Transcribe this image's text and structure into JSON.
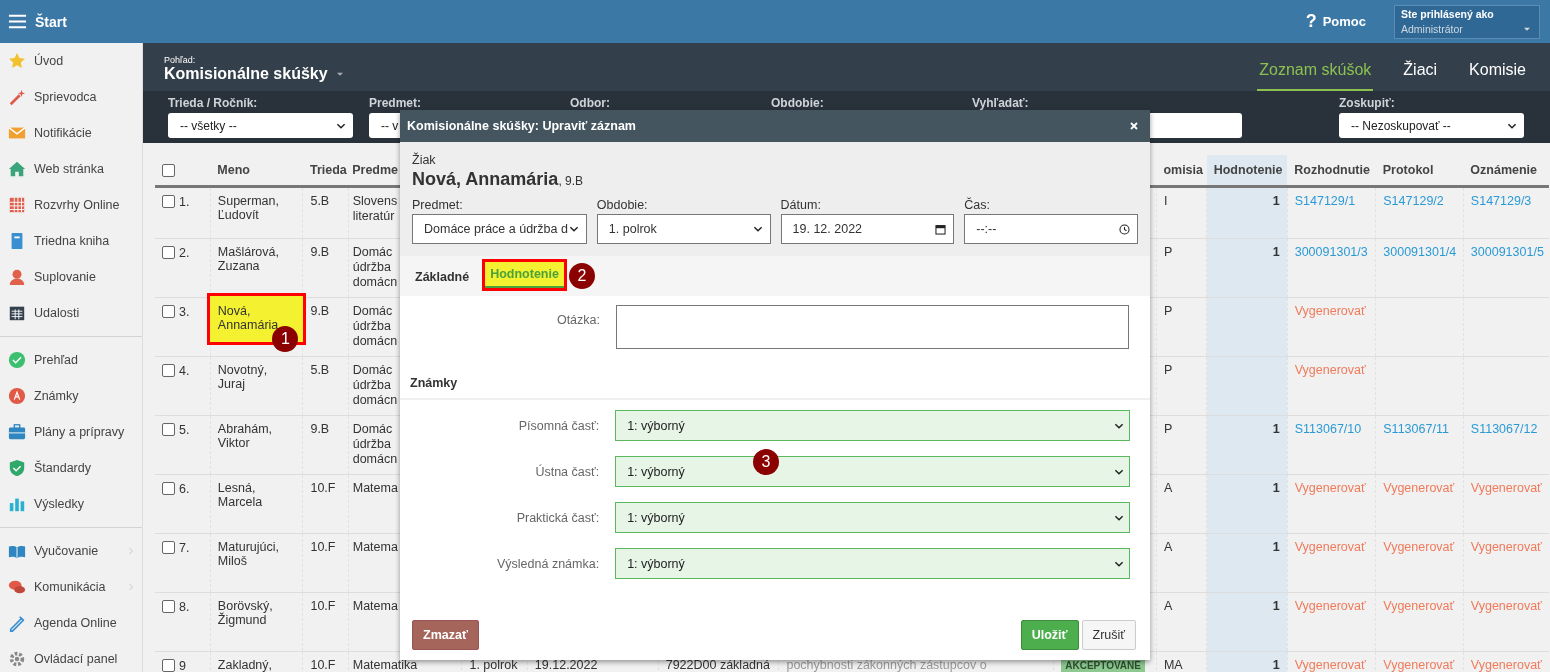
{
  "topbar": {
    "title": "Štart",
    "help_icon": "?",
    "help": "Pomoc",
    "user_caption": "Ste prihlásený ako",
    "user_name": "Administrátor"
  },
  "sidebar": {
    "groups": [
      [
        {
          "label": "Úvod",
          "has_submenu": false
        },
        {
          "label": "Sprievodca",
          "has_submenu": false
        },
        {
          "label": "Notifikácie",
          "has_submenu": false
        },
        {
          "label": "Web stránka",
          "has_submenu": false
        },
        {
          "label": "Rozvrhy Online",
          "has_submenu": false
        },
        {
          "label": "Triedna kniha",
          "has_submenu": false
        },
        {
          "label": "Suplovanie",
          "has_submenu": false
        },
        {
          "label": "Udalosti",
          "has_submenu": false
        }
      ],
      [
        {
          "label": "Prehľad",
          "has_submenu": false
        },
        {
          "label": "Známky",
          "has_submenu": false
        },
        {
          "label": "Plány a prípravy",
          "has_submenu": false
        },
        {
          "label": "Štandardy",
          "has_submenu": false
        },
        {
          "label": "Výsledky",
          "has_submenu": false
        }
      ],
      [
        {
          "label": "Vyučovanie",
          "has_submenu": true
        },
        {
          "label": "Komunikácia",
          "has_submenu": true
        },
        {
          "label": "Agenda Online",
          "has_submenu": false
        },
        {
          "label": "Ovládací panel",
          "has_submenu": false
        }
      ]
    ]
  },
  "view": {
    "caption": "Pohľad:",
    "title": "Komisionálne skúšky"
  },
  "view_tabs": [
    {
      "label": "Zoznam skúšok",
      "selected": true
    },
    {
      "label": "Žiaci",
      "selected": false
    },
    {
      "label": "Komisie",
      "selected": false
    }
  ],
  "filters": [
    {
      "label": "Trieda / Ročník:",
      "kind": "select",
      "value": "-- všetky --"
    },
    {
      "label": "Predmet:",
      "kind": "select",
      "value": "-- v"
    },
    {
      "label": "Odbor:",
      "kind": "hidden"
    },
    {
      "label": "Obdobie:",
      "kind": "hidden"
    },
    {
      "label": "Vyhľadať:",
      "kind": "search"
    },
    {
      "label": "Zoskupiť:",
      "kind": "select",
      "value": "-- Nezoskupovať --"
    }
  ],
  "table": {
    "select_all_checked": false,
    "columns": [
      "Meno",
      "Trieda",
      "Predme",
      "omisia",
      "Hodnotenie",
      "Rozhodnutie",
      "Protokol",
      "Oznámenie"
    ],
    "rows": [
      {
        "number": "1.",
        "checked": false,
        "name": "Superman, Ľudovít",
        "highlighted": false,
        "class": "5.B",
        "subject": [
          "Slovens",
          "literatúr"
        ],
        "commission": "I",
        "grade": "1",
        "decision": {
          "text": "S147129/1",
          "kind": "link"
        },
        "protocol": {
          "text": "S147129/2",
          "kind": "link"
        },
        "notice": {
          "text": "S147129/3",
          "kind": "link"
        }
      },
      {
        "number": "2.",
        "checked": false,
        "name": "Mašlárová, Zuzana",
        "highlighted": false,
        "class": "9.B",
        "subject": [
          "Domác",
          "údržba",
          "domácn"
        ],
        "commission": "P",
        "grade": "1",
        "decision": {
          "text": "300091301/3",
          "kind": "link"
        },
        "protocol": {
          "text": "300091301/4",
          "kind": "link"
        },
        "notice": {
          "text": "300091301/5",
          "kind": "link"
        }
      },
      {
        "number": "3.",
        "checked": false,
        "name": "Nová, Annamária",
        "highlighted": true,
        "marker": "1",
        "class": "9.B",
        "subject": [
          "Domác",
          "údržba",
          "domácn"
        ],
        "commission": "P",
        "decision": {
          "text": "Vygenerovať",
          "kind": "generate"
        }
      },
      {
        "number": "4.",
        "checked": false,
        "name": "Novotný, Juraj",
        "highlighted": false,
        "class": "5.B",
        "subject": [
          "Domác",
          "údržba",
          "domácn"
        ],
        "commission": "P",
        "decision": {
          "text": "Vygenerovať",
          "kind": "generate"
        }
      },
      {
        "number": "5.",
        "checked": false,
        "name": "Abrahám, Viktor",
        "highlighted": false,
        "class": "9.B",
        "subject": [
          "Domác",
          "údržba",
          "domácn"
        ],
        "commission": "P",
        "grade": "1",
        "decision": {
          "text": "S113067/10",
          "kind": "link"
        },
        "protocol": {
          "text": "S113067/11",
          "kind": "link"
        },
        "notice": {
          "text": "S113067/12",
          "kind": "link"
        }
      },
      {
        "number": "6.",
        "checked": false,
        "name": "Lesná, Marcela",
        "highlighted": false,
        "class": "10.F",
        "subject": [
          "Matema"
        ],
        "commission": "A",
        "grade": "1",
        "decision": {
          "text": "Vygenerovať",
          "kind": "generate"
        },
        "protocol": {
          "text": "Vygenerovať",
          "kind": "generate"
        },
        "notice": {
          "text": "Vygenerovať",
          "kind": "generate"
        }
      },
      {
        "number": "7.",
        "checked": false,
        "name": "Maturujúci, Miloš",
        "highlighted": false,
        "class": "10.F",
        "subject": [
          "Matema"
        ],
        "commission": "A",
        "grade": "1",
        "decision": {
          "text": "Vygenerovať",
          "kind": "generate"
        },
        "protocol": {
          "text": "Vygenerovať",
          "kind": "generate"
        },
        "notice": {
          "text": "Vygenerovať",
          "kind": "generate"
        }
      },
      {
        "number": "8.",
        "checked": false,
        "name": "Borövský, Žigmund",
        "highlighted": false,
        "class": "10.F",
        "subject": [
          "Matema"
        ],
        "commission": "A",
        "grade": "1",
        "decision": {
          "text": "Vygenerovať",
          "kind": "generate"
        },
        "protocol": {
          "text": "Vygenerovať",
          "kind": "generate"
        },
        "notice": {
          "text": "Vygenerovať",
          "kind": "generate"
        }
      },
      {
        "number": "9",
        "checked": false,
        "name": "Zakladný,",
        "highlighted": false,
        "class": "10.F",
        "subject": [
          "Matematika"
        ],
        "term": "1. polrok",
        "date": "19.12.2022",
        "code": "7922D00 základná",
        "reason": "pochybnosti zákonných zástupcov o",
        "status": "AKCEPTOVANÉ",
        "commission": "MA",
        "grade": "1",
        "decision": {
          "text": "Vygenerovať",
          "kind": "generate"
        },
        "protocol": {
          "text": "Vygenerovať",
          "kind": "generate"
        },
        "notice": {
          "text": "Vygenerovať",
          "kind": "generate"
        }
      }
    ]
  },
  "dialog": {
    "title": "Komisionálne skúšky: Upraviť záznam",
    "student_caption": "Žiak",
    "student_name": "Nová, Annamária",
    "student_class": ", 9.B",
    "fields": [
      {
        "label": "Predmet:",
        "kind": "select",
        "value": "Domáce práce a údržba d"
      },
      {
        "label": "Obdobie:",
        "kind": "select",
        "value": "1. polrok"
      },
      {
        "label": "Dátum:",
        "kind": "date",
        "value": "19. 12. 2022"
      },
      {
        "label": "Čas:",
        "kind": "time",
        "value": "--:--"
      }
    ],
    "tabs": [
      {
        "label": "Základné",
        "selected": false,
        "highlighted": false
      },
      {
        "label": "Hodnotenie",
        "selected": true,
        "highlighted": true,
        "marker": "2"
      }
    ],
    "question_label": "Otázka:",
    "grades_heading": "Známky",
    "grades": [
      {
        "label": "Písomná časť:",
        "value": "1: výborný"
      },
      {
        "label": "Ústna časť:",
        "value": "1: výborný",
        "marker": "3"
      },
      {
        "label": "Praktická časť:",
        "value": "1: výborný"
      },
      {
        "label": "Výsledná známka:",
        "value": "1: výborný"
      }
    ],
    "delete": "Zmazať",
    "save": "Uložiť",
    "cancel": "Zrušiť"
  }
}
